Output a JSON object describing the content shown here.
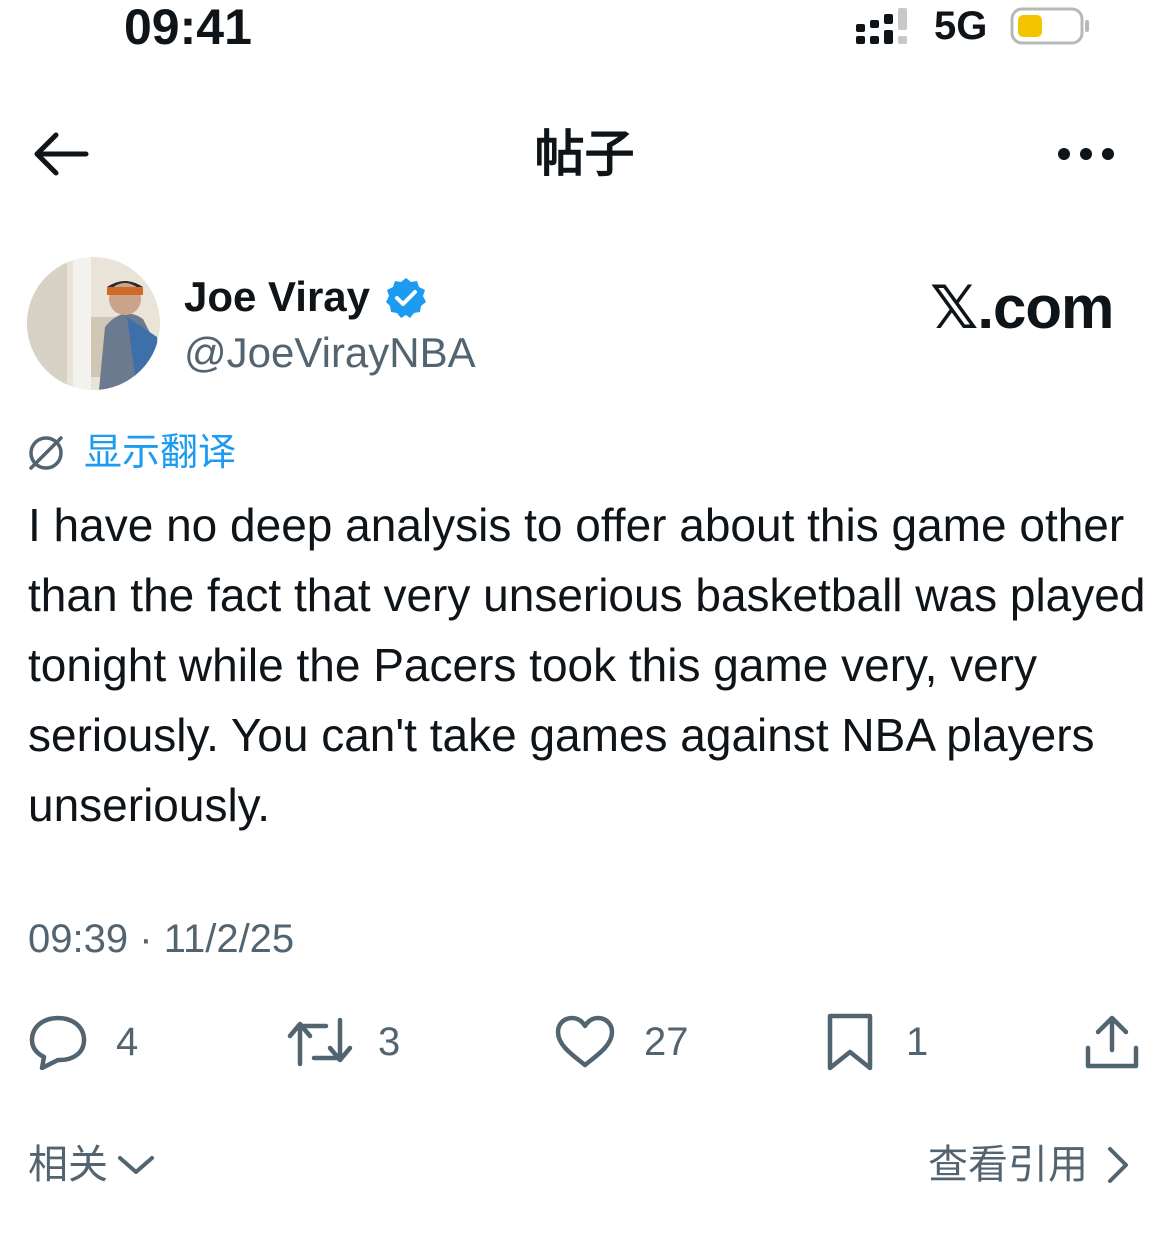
{
  "status_bar": {
    "time": "09:41",
    "network": "5G",
    "battery_color": "#f5c400"
  },
  "nav": {
    "title": "帖子"
  },
  "author": {
    "name": "Joe Viray",
    "handle": "@JoeVirayNBA",
    "verified_color": "#1d9bf0"
  },
  "brand": "𝕏.com",
  "translate": {
    "label": "显示翻译",
    "icon": "translate-off-icon"
  },
  "tweet": {
    "text": "I have no deep analysis to offer about this game other than the fact that very unserious basketball was played tonight while the Pacers took this game very, very seriously. You can't take games against NBA players unseriously.",
    "time": "09:39",
    "separator": "·",
    "date": "11/2/25"
  },
  "actions": {
    "replies": "4",
    "reposts": "3",
    "likes": "27",
    "bookmarks": "1"
  },
  "footer": {
    "related_label": "相关",
    "view_quotes_label": "查看引用"
  },
  "colors": {
    "text": "#0f1419",
    "secondary": "#536471",
    "link": "#1d9bf0"
  }
}
